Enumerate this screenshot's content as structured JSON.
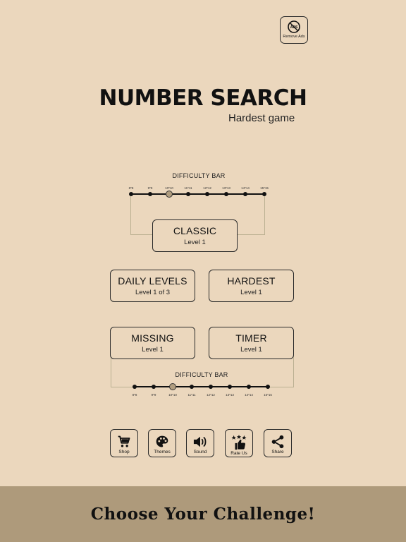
{
  "remove_ads": {
    "label": "Remove Ads",
    "icon": "no-ads-icon",
    "badge": "ADS"
  },
  "header": {
    "title": "NUMBER SEARCH",
    "subtitle": "Hardest game"
  },
  "difficulty_top": {
    "label": "DIFFICULTY BAR",
    "ticks": [
      "8*8",
      "9*9",
      "10*10",
      "11*11",
      "12*12",
      "13*13",
      "14*14",
      "15*15"
    ],
    "selected_index": 2
  },
  "difficulty_bottom": {
    "label": "DIFFICULTY BAR",
    "ticks": [
      "8*8",
      "9*9",
      "10*10",
      "11*11",
      "12*12",
      "13*13",
      "14*14",
      "15*15"
    ],
    "selected_index": 2
  },
  "modes": {
    "classic": {
      "name": "CLASSIC",
      "sub": "Level 1"
    },
    "daily": {
      "name": "DAILY LEVELS",
      "sub": "Level 1 of 3"
    },
    "hardest": {
      "name": "HARDEST",
      "sub": "Level 1"
    },
    "missing": {
      "name": "MISSING",
      "sub": "Level 1"
    },
    "timer": {
      "name": "TIMER",
      "sub": "Level 1"
    }
  },
  "toolbar": [
    {
      "label": "Shop",
      "icon": "cart-icon"
    },
    {
      "label": "Themes",
      "icon": "palette-icon"
    },
    {
      "label": "Sound",
      "icon": "speaker-icon"
    },
    {
      "label": "Rate Us",
      "icon": "thumbs-up-stars-icon"
    },
    {
      "label": "Share",
      "icon": "share-icon"
    }
  ],
  "footer": {
    "text": "Choose Your Challenge!"
  },
  "colors": {
    "background": "#ebd7bd",
    "footer": "#ae9a7b",
    "selected_dot": "#b09d7f"
  }
}
